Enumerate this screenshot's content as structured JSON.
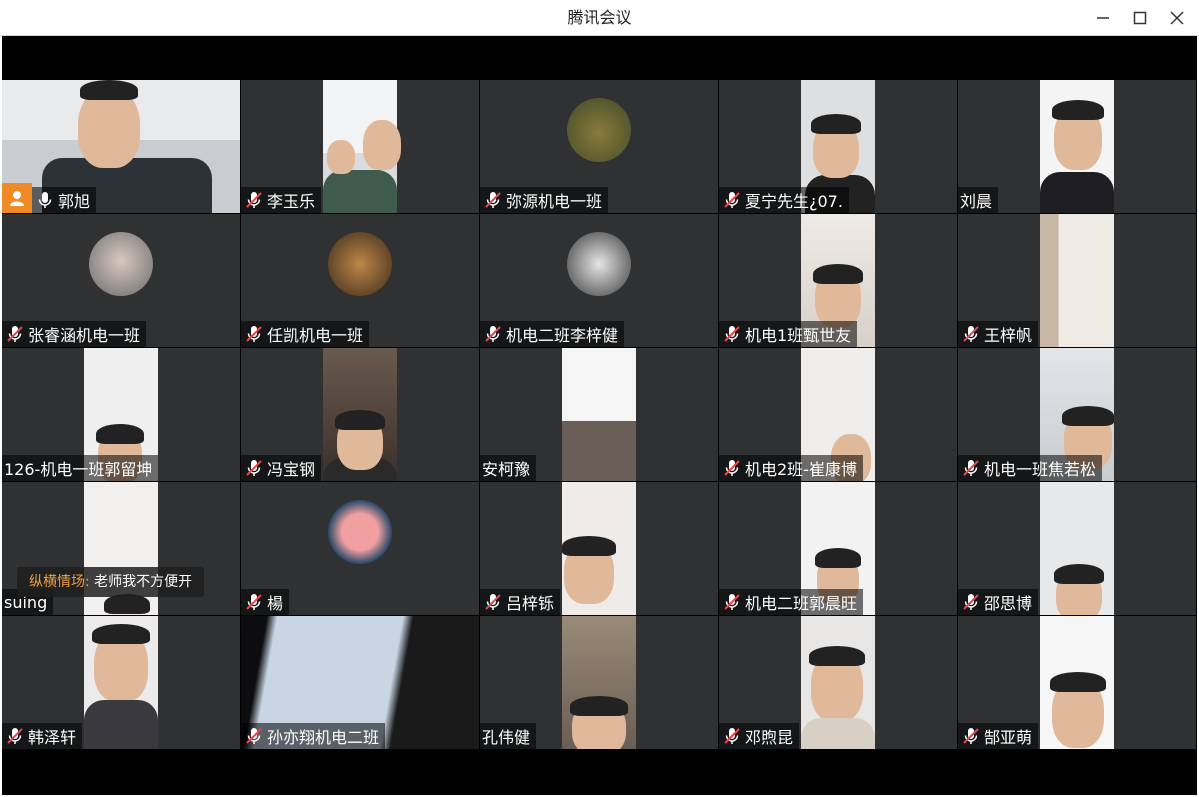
{
  "window": {
    "title": "腾讯会议"
  },
  "controls": {
    "minimize": "minimize",
    "maximize": "maximize",
    "close": "close"
  },
  "participants": [
    {
      "name": "郭旭",
      "mic": "on",
      "host": true
    },
    {
      "name": "李玉乐",
      "mic": "muted"
    },
    {
      "name": "弥源机电一班",
      "mic": "muted"
    },
    {
      "name": "夏宁先生¿07.",
      "mic": "muted"
    },
    {
      "name": "刘晨",
      "mic": "none"
    },
    {
      "name": "张睿涵机电一班",
      "mic": "muted"
    },
    {
      "name": "任凯机电一班",
      "mic": "muted"
    },
    {
      "name": "机电二班李梓健",
      "mic": "muted"
    },
    {
      "name": "机电1班甄世友",
      "mic": "muted"
    },
    {
      "name": "王梓帆",
      "mic": "muted"
    },
    {
      "name": "126-机电一班郭留坤",
      "mic": "none"
    },
    {
      "name": "冯宝钢",
      "mic": "muted"
    },
    {
      "name": "安柯豫",
      "mic": "none"
    },
    {
      "name": "机电2班-崔康博",
      "mic": "muted"
    },
    {
      "name": "机电一班焦若松",
      "mic": "muted"
    },
    {
      "name": "suing",
      "mic": "none"
    },
    {
      "name": "楊",
      "mic": "muted"
    },
    {
      "name": "吕梓铄",
      "mic": "muted"
    },
    {
      "name": "机电二班郭晨旺",
      "mic": "muted"
    },
    {
      "name": "邵思博",
      "mic": "muted"
    },
    {
      "name": "韩泽轩",
      "mic": "muted"
    },
    {
      "name": "孙亦翔机电二班",
      "mic": "muted"
    },
    {
      "name": "孔伟健",
      "mic": "none"
    },
    {
      "name": "邓煦昆",
      "mic": "muted"
    },
    {
      "name": "郜亚萌",
      "mic": "muted"
    }
  ],
  "chat_popup": {
    "sender": "纵横情场:",
    "message": "老师我不方便开"
  },
  "colors": {
    "tile_bg": "#2f3133",
    "host_badge": "#f08a24",
    "chat_sender": "#f0a040"
  }
}
